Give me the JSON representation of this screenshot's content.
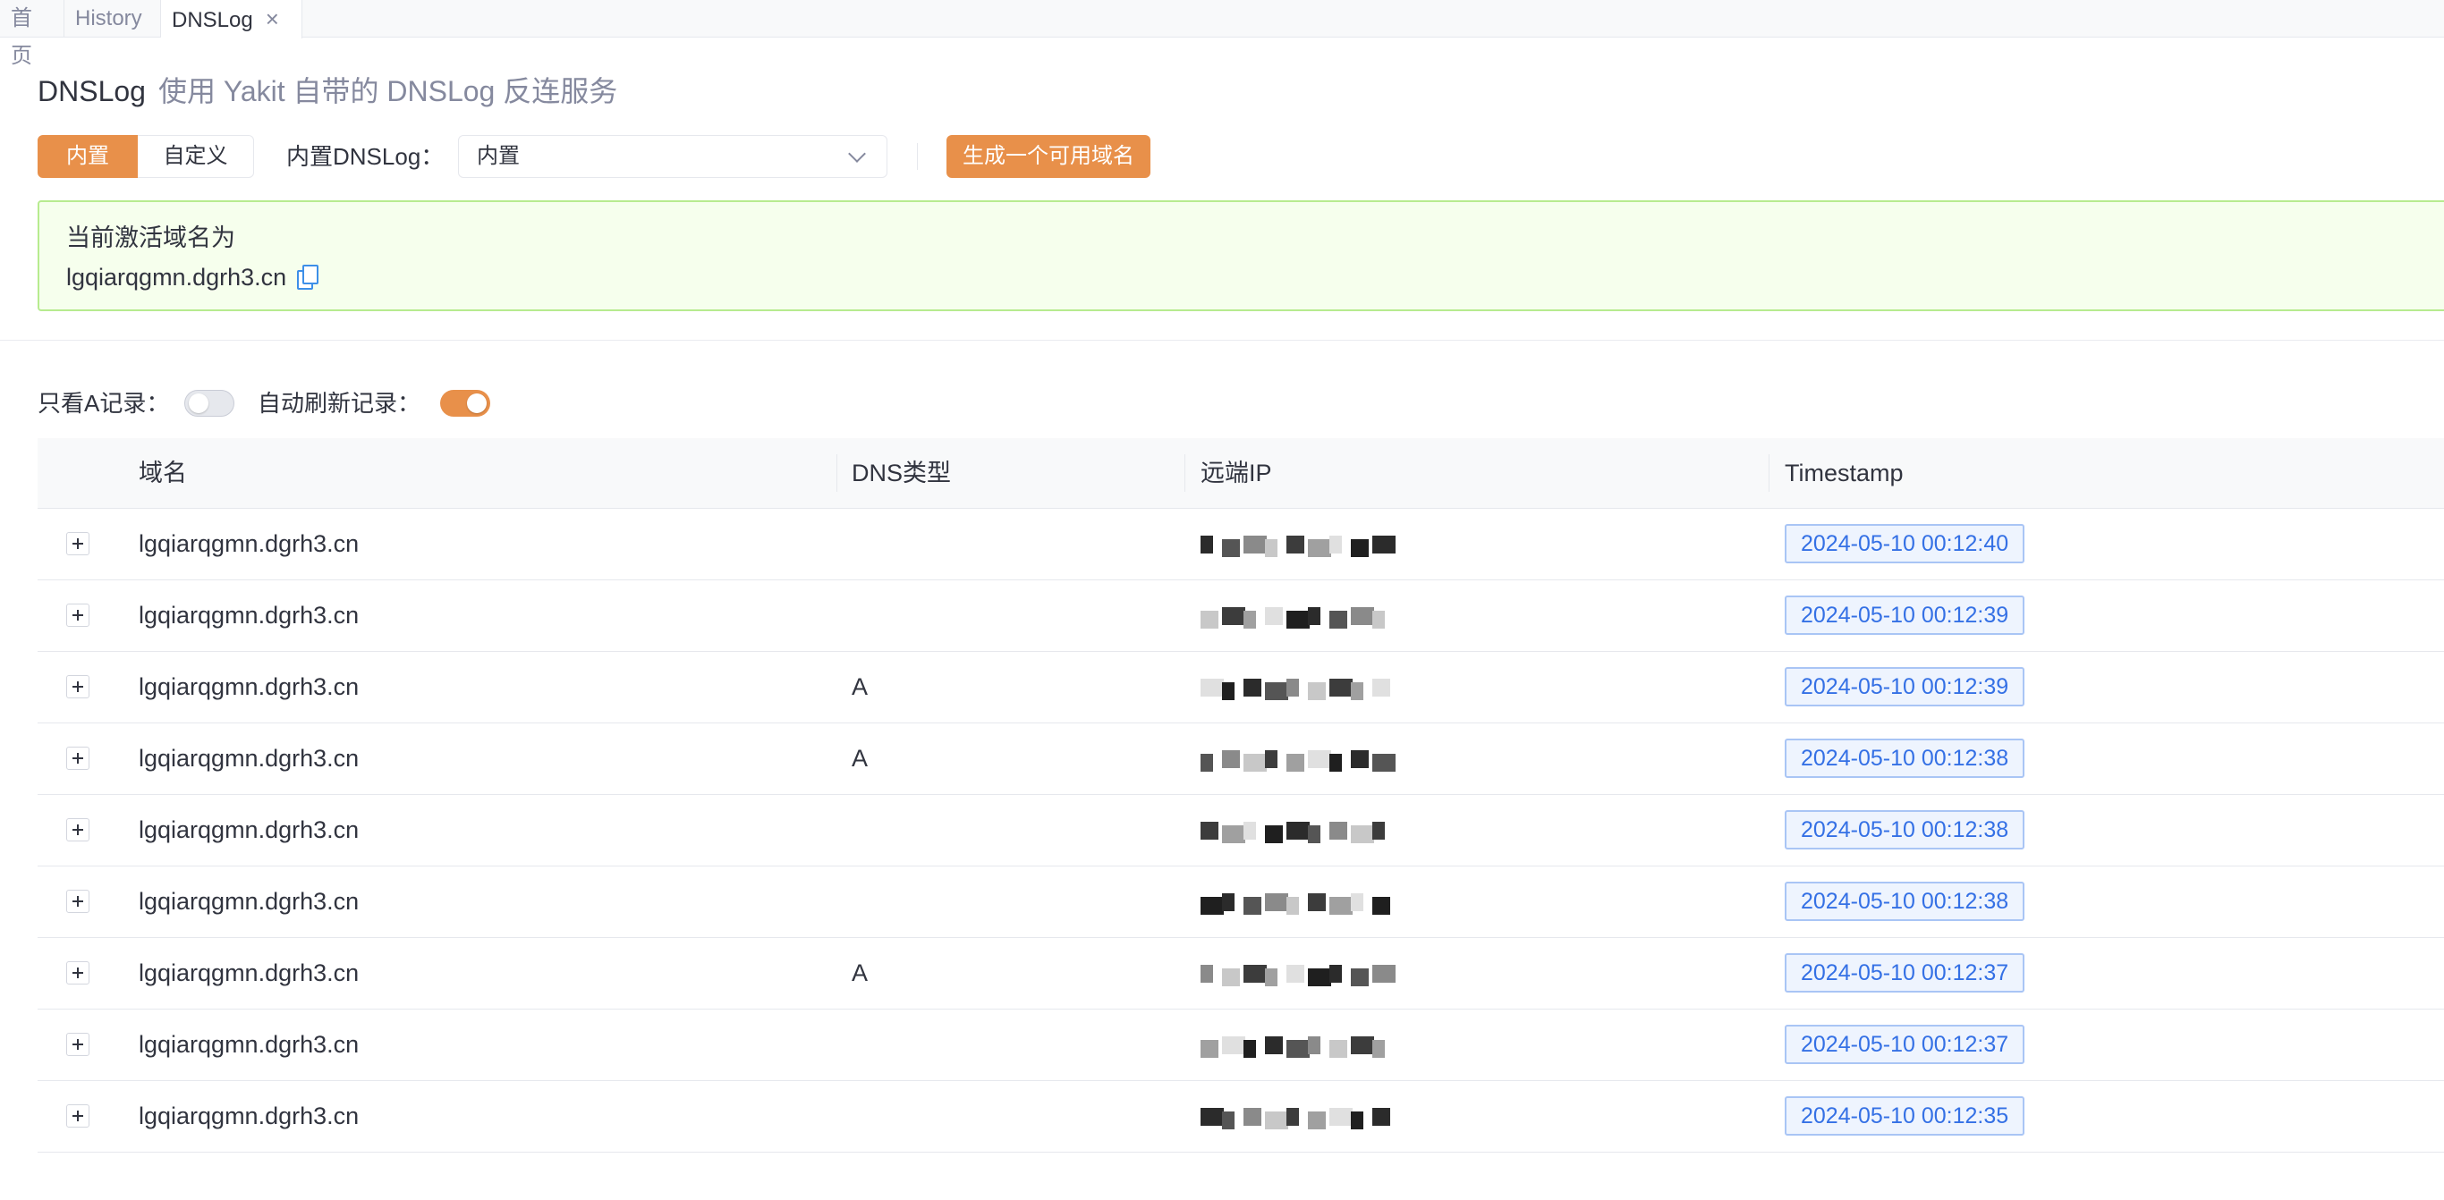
{
  "tabs": [
    {
      "label": "首页",
      "active": false
    },
    {
      "label": "History",
      "active": false
    },
    {
      "label": "DNSLog",
      "active": true,
      "closable": true
    }
  ],
  "page": {
    "title": "DNSLog",
    "subtitle": "使用 Yakit 自带的 DNSLog 反连服务"
  },
  "mode_switch": {
    "options": [
      "内置",
      "自定义"
    ],
    "selected": "内置"
  },
  "dnslog_select": {
    "label": "内置DNSLog：",
    "value": "内置"
  },
  "generate_button": "生成一个可用域名",
  "active_domain": {
    "label": "当前激活域名为",
    "domain": "lgqiarqgmn.dgrh3.cn",
    "icon": "copy-icon"
  },
  "filters": {
    "only_a_label": "只看A记录：",
    "only_a": false,
    "auto_refresh_label": "自动刷新记录：",
    "auto_refresh": true
  },
  "table": {
    "columns": [
      "域名",
      "DNS类型",
      "远端IP",
      "Timestamp"
    ],
    "rows": [
      {
        "domain": "lgqiarqgmn.dgrh3.cn",
        "type": "",
        "ip": "[redacted]",
        "timestamp": "2024-05-10 00:12:40"
      },
      {
        "domain": "lgqiarqgmn.dgrh3.cn",
        "type": "",
        "ip": "[redacted]",
        "timestamp": "2024-05-10 00:12:39"
      },
      {
        "domain": "lgqiarqgmn.dgrh3.cn",
        "type": "A",
        "ip": "[redacted]",
        "timestamp": "2024-05-10 00:12:39"
      },
      {
        "domain": "lgqiarqgmn.dgrh3.cn",
        "type": "A",
        "ip": "[redacted]",
        "timestamp": "2024-05-10 00:12:38"
      },
      {
        "domain": "lgqiarqgmn.dgrh3.cn",
        "type": "",
        "ip": "[redacted]",
        "timestamp": "2024-05-10 00:12:38"
      },
      {
        "domain": "lgqiarqgmn.dgrh3.cn",
        "type": "",
        "ip": "[redacted]",
        "timestamp": "2024-05-10 00:12:38"
      },
      {
        "domain": "lgqiarqgmn.dgrh3.cn",
        "type": "A",
        "ip": "[redacted]",
        "timestamp": "2024-05-10 00:12:37"
      },
      {
        "domain": "lgqiarqgmn.dgrh3.cn",
        "type": "",
        "ip": "[redacted]",
        "timestamp": "2024-05-10 00:12:37"
      },
      {
        "domain": "lgqiarqgmn.dgrh3.cn",
        "type": "",
        "ip": "[redacted]",
        "timestamp": "2024-05-10 00:12:35"
      }
    ]
  },
  "colors": {
    "accent": "#e8904a",
    "success_bg": "#f6ffed",
    "success_border": "#b7eb8f",
    "tag_blue": "#3470e5"
  }
}
